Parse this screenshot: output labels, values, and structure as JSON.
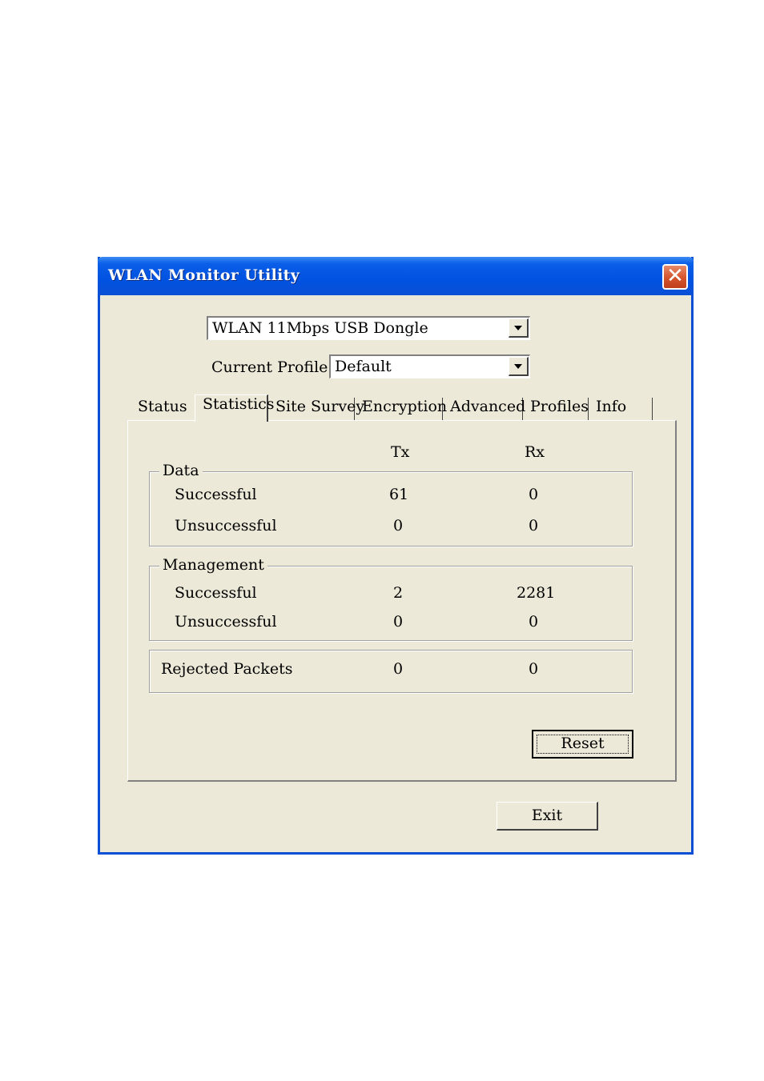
{
  "window": {
    "title": "WLAN Monitor Utility",
    "close_glyph": "✕"
  },
  "adapter": {
    "selected": "WLAN 11Mbps USB Dongle"
  },
  "profile": {
    "label": "Current Profile:",
    "selected": "Default"
  },
  "tabs": [
    "Status",
    "Statistics",
    "Site Survey",
    "Encryption",
    "Advanced",
    "Profiles",
    "Info"
  ],
  "active_tab": "Statistics",
  "stats": {
    "col_tx": "Tx",
    "col_rx": "Rx",
    "data": {
      "title": "Data",
      "rows": [
        {
          "label": "Successful",
          "tx": "61",
          "rx": "0"
        },
        {
          "label": "Unsuccessful",
          "tx": "0",
          "rx": "0"
        }
      ]
    },
    "management": {
      "title": "Management",
      "rows": [
        {
          "label": "Successful",
          "tx": "2",
          "rx": "2281"
        },
        {
          "label": "Unsuccessful",
          "tx": "0",
          "rx": "0"
        }
      ]
    },
    "rejected": {
      "label": "Rejected Packets",
      "tx": "0",
      "rx": "0"
    }
  },
  "buttons": {
    "reset": "Reset",
    "exit": "Exit"
  },
  "icons": {
    "close": "close-icon",
    "dropdown": "chevron-down-icon"
  },
  "colors": {
    "title_bar": "#0a5ee8",
    "face": "#ece9d8",
    "close": "#d4542c"
  }
}
